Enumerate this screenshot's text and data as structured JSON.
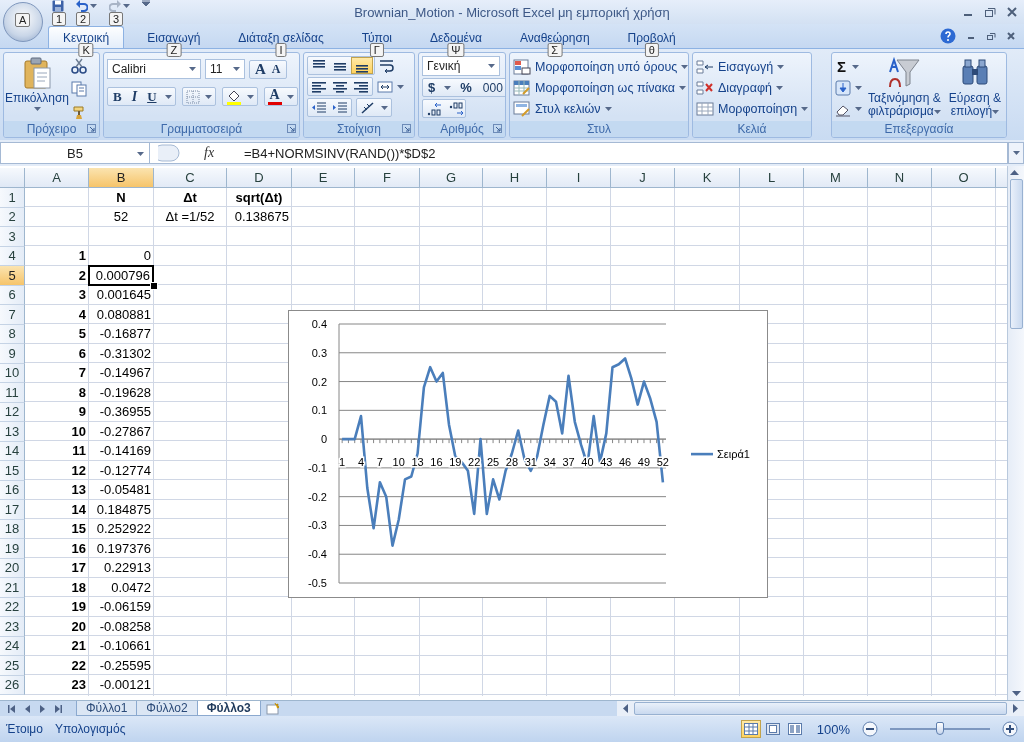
{
  "window": {
    "title": "Brownian_Motion - Microsoft Excel μη εμπορική χρήση",
    "office_keytip": "A",
    "quick_access_keytips": [
      "1",
      "2",
      "3"
    ]
  },
  "tabs": [
    {
      "label": "Κεντρική",
      "keytip": "Κ",
      "selected": true
    },
    {
      "label": "Εισαγωγή",
      "keytip": "Ζ",
      "selected": false
    },
    {
      "label": "Διάταξη σελίδας",
      "keytip": "Ι",
      "selected": false
    },
    {
      "label": "Τύποι",
      "keytip": "Γ",
      "selected": false
    },
    {
      "label": "Δεδομένα",
      "keytip": "Ψ",
      "selected": false
    },
    {
      "label": "Αναθεώρηση",
      "keytip": "Σ",
      "selected": false
    },
    {
      "label": "Προβολή",
      "keytip": "θ",
      "selected": false
    }
  ],
  "ribbon": {
    "groups": [
      {
        "kind": "clipboard",
        "label": "Πρόχειρο",
        "paste_label": "Επικόλληση"
      },
      {
        "kind": "font",
        "label": "Γραμματοσειρά",
        "font_name": "Calibri",
        "font_size": "11",
        "grow_label": "A",
        "shrink_label": "A",
        "bold_label": "B",
        "italic_label": "I",
        "underline_label": "U",
        "font_color_label": "A"
      },
      {
        "kind": "alignment",
        "label": "Στοίχιση",
        "vertical_align": [
          {
            "selected": false
          },
          {
            "selected": false
          },
          {
            "selected": true
          }
        ]
      },
      {
        "kind": "number",
        "label": "Αριθμός",
        "format": "Γενική",
        "currency_label": "$",
        "percent_label": "%",
        "thousands_label": "000"
      },
      {
        "kind": "styles",
        "label": "Στυλ",
        "items": [
          "Μορφοποίηση υπό όρους",
          "Μορφοποίηση ως πίνακα",
          "Στυλ κελιών"
        ]
      },
      {
        "kind": "cells",
        "label": "Κελιά",
        "items": [
          "Εισαγωγή",
          "Διαγραφή",
          "Μορφοποίηση"
        ]
      },
      {
        "kind": "editing",
        "label": "Επεξεργασία",
        "sum_label": "Σ",
        "sort_label": "Ταξινόμηση & φιλτράρισμα",
        "find_label": "Εύρεση & επιλογή"
      }
    ]
  },
  "formula_bar": {
    "name_box": "B5",
    "fx": "fx",
    "formula": "=B4+NORMSINV(RAND())*$D$2"
  },
  "sheet": {
    "columns": [
      {
        "label": "A",
        "selected": false
      },
      {
        "label": "B",
        "selected": true
      },
      {
        "label": "C",
        "selected": false
      },
      {
        "label": "D",
        "selected": false
      },
      {
        "label": "E",
        "selected": false
      },
      {
        "label": "F",
        "selected": false
      },
      {
        "label": "G",
        "selected": false
      },
      {
        "label": "H",
        "selected": false
      },
      {
        "label": "I",
        "selected": false
      },
      {
        "label": "J",
        "selected": false
      },
      {
        "label": "K",
        "selected": false
      },
      {
        "label": "L",
        "selected": false
      },
      {
        "label": "M",
        "selected": false
      },
      {
        "label": "N",
        "selected": false
      },
      {
        "label": "O",
        "selected": false
      }
    ],
    "rows": [
      {
        "number": "1",
        "selected": false,
        "cells": {
          "B": {
            "text": "N",
            "bold": true,
            "centered": true
          },
          "C": {
            "text": "Δt",
            "bold": true,
            "centered": true
          },
          "D": {
            "text": "sqrt(Δt)",
            "bold": true,
            "centered": true
          }
        }
      },
      {
        "number": "2",
        "selected": false,
        "cells": {
          "B": {
            "text": "52",
            "bold": false,
            "centered": true
          },
          "C": {
            "text": "Δt =1/52",
            "bold": false,
            "centered": true
          },
          "D": {
            "text": "0.138675",
            "bold": false,
            "centered": false
          }
        }
      },
      {
        "number": "3",
        "selected": false
      },
      {
        "number": "4",
        "selected": false,
        "cells": {
          "A": {
            "text": "1",
            "bold": true,
            "centered": false
          },
          "B": {
            "text": "0",
            "bold": false,
            "centered": false
          }
        }
      },
      {
        "number": "5",
        "selected": true,
        "cells": {
          "A": {
            "text": "2",
            "bold": true,
            "centered": false
          },
          "B": {
            "text": "0.000796",
            "bold": false,
            "centered": false
          }
        }
      },
      {
        "number": "6",
        "selected": false,
        "cells": {
          "A": {
            "text": "3",
            "bold": true,
            "centered": false
          },
          "B": {
            "text": "0.001645",
            "bold": false,
            "centered": false
          }
        }
      },
      {
        "number": "7",
        "selected": false,
        "cells": {
          "A": {
            "text": "4",
            "bold": true,
            "centered": false
          },
          "B": {
            "text": "0.080881",
            "bold": false,
            "centered": false
          }
        }
      },
      {
        "number": "8",
        "selected": false,
        "cells": {
          "A": {
            "text": "5",
            "bold": true,
            "centered": false
          },
          "B": {
            "text": "-0.16877",
            "bold": false,
            "centered": false
          }
        }
      },
      {
        "number": "9",
        "selected": false,
        "cells": {
          "A": {
            "text": "6",
            "bold": true,
            "centered": false
          },
          "B": {
            "text": "-0.31302",
            "bold": false,
            "centered": false
          }
        }
      },
      {
        "number": "10",
        "selected": false,
        "cells": {
          "A": {
            "text": "7",
            "bold": true,
            "centered": false
          },
          "B": {
            "text": "-0.14967",
            "bold": false,
            "centered": false
          }
        }
      },
      {
        "number": "11",
        "selected": false,
        "cells": {
          "A": {
            "text": "8",
            "bold": true,
            "centered": false
          },
          "B": {
            "text": "-0.19628",
            "bold": false,
            "centered": false
          }
        }
      },
      {
        "number": "12",
        "selected": false,
        "cells": {
          "A": {
            "text": "9",
            "bold": true,
            "centered": false
          },
          "B": {
            "text": "-0.36955",
            "bold": false,
            "centered": false
          }
        }
      },
      {
        "number": "13",
        "selected": false,
        "cells": {
          "A": {
            "text": "10",
            "bold": true,
            "centered": false
          },
          "B": {
            "text": "-0.27867",
            "bold": false,
            "centered": false
          }
        }
      },
      {
        "number": "14",
        "selected": false,
        "cells": {
          "A": {
            "text": "11",
            "bold": true,
            "centered": false
          },
          "B": {
            "text": "-0.14169",
            "bold": false,
            "centered": false
          }
        }
      },
      {
        "number": "15",
        "selected": false,
        "cells": {
          "A": {
            "text": "12",
            "bold": true,
            "centered": false
          },
          "B": {
            "text": "-0.12774",
            "bold": false,
            "centered": false
          }
        }
      },
      {
        "number": "16",
        "selected": false,
        "cells": {
          "A": {
            "text": "13",
            "bold": true,
            "centered": false
          },
          "B": {
            "text": "-0.05481",
            "bold": false,
            "centered": false
          }
        }
      },
      {
        "number": "17",
        "selected": false,
        "cells": {
          "A": {
            "text": "14",
            "bold": true,
            "centered": false
          },
          "B": {
            "text": "0.184875",
            "bold": false,
            "centered": false
          }
        }
      },
      {
        "number": "18",
        "selected": false,
        "cells": {
          "A": {
            "text": "15",
            "bold": true,
            "centered": false
          },
          "B": {
            "text": "0.252922",
            "bold": false,
            "centered": false
          }
        }
      },
      {
        "number": "19",
        "selected": false,
        "cells": {
          "A": {
            "text": "16",
            "bold": true,
            "centered": false
          },
          "B": {
            "text": "0.197376",
            "bold": false,
            "centered": false
          }
        }
      },
      {
        "number": "20",
        "selected": false,
        "cells": {
          "A": {
            "text": "17",
            "bold": true,
            "centered": false
          },
          "B": {
            "text": "0.22913",
            "bold": false,
            "centered": false
          }
        }
      },
      {
        "number": "21",
        "selected": false,
        "cells": {
          "A": {
            "text": "18",
            "bold": true,
            "centered": false
          },
          "B": {
            "text": "0.0472",
            "bold": false,
            "centered": false
          }
        }
      },
      {
        "number": "22",
        "selected": false,
        "cells": {
          "A": {
            "text": "19",
            "bold": true,
            "centered": false
          },
          "B": {
            "text": "-0.06159",
            "bold": false,
            "centered": false
          }
        }
      },
      {
        "number": "23",
        "selected": false,
        "cells": {
          "A": {
            "text": "20",
            "bold": true,
            "centered": false
          },
          "B": {
            "text": "-0.08258",
            "bold": false,
            "centered": false
          }
        }
      },
      {
        "number": "24",
        "selected": false,
        "cells": {
          "A": {
            "text": "21",
            "bold": true,
            "centered": false
          },
          "B": {
            "text": "-0.10661",
            "bold": false,
            "centered": false
          }
        }
      },
      {
        "number": "25",
        "selected": false,
        "cells": {
          "A": {
            "text": "22",
            "bold": true,
            "centered": false
          },
          "B": {
            "text": "-0.25595",
            "bold": false,
            "centered": false
          }
        }
      },
      {
        "number": "26",
        "selected": false,
        "cells": {
          "A": {
            "text": "23",
            "bold": true,
            "centered": false
          },
          "B": {
            "text": "-0.00121",
            "bold": false,
            "centered": false
          }
        }
      }
    ],
    "chart": {
      "chart_data": {
        "type": "line",
        "x": [
          1,
          2,
          3,
          4,
          5,
          6,
          7,
          8,
          9,
          10,
          11,
          12,
          13,
          14,
          15,
          16,
          17,
          18,
          19,
          20,
          21,
          22,
          23,
          24,
          25,
          26,
          27,
          28,
          29,
          30,
          31,
          32,
          33,
          34,
          35,
          36,
          37,
          38,
          39,
          40,
          41,
          42,
          43,
          44,
          45,
          46,
          47,
          48,
          49,
          50,
          51,
          52
        ],
        "xlim": [
          0.5,
          52.5
        ],
        "xticks": [
          1,
          4,
          7,
          10,
          13,
          16,
          19,
          22,
          25,
          28,
          31,
          34,
          37,
          40,
          43,
          46,
          49,
          52
        ],
        "ylim": [
          -0.5,
          0.4
        ],
        "yticks": [
          -0.5,
          -0.4,
          -0.3,
          -0.2,
          -0.1,
          0,
          0.1,
          0.2,
          0.3,
          0.4
        ],
        "grid": true,
        "series": [
          {
            "name": "Σειρά1",
            "color": "#4a7ebb",
            "values": [
              0,
              0,
              0,
              0.08,
              -0.17,
              -0.31,
              -0.15,
              -0.2,
              -0.37,
              -0.28,
              -0.14,
              -0.13,
              -0.05,
              0.18,
              0.25,
              0.2,
              0.23,
              0.05,
              -0.06,
              -0.08,
              -0.11,
              -0.26,
              0,
              -0.26,
              -0.14,
              -0.21,
              -0.11,
              -0.05,
              0.03,
              -0.07,
              -0.11,
              -0.06,
              0.05,
              0.15,
              0.13,
              0.02,
              0.22,
              0.06,
              -0.02,
              -0.09,
              0.08,
              -0.08,
              0.02,
              0.25,
              0.26,
              0.28,
              0.21,
              0.12,
              0.2,
              0.14,
              0.06,
              -0.15
            ]
          }
        ]
      }
    }
  },
  "sheet_tabs": [
    {
      "label": "Φύλλο1",
      "selected": false
    },
    {
      "label": "Φύλλο2",
      "selected": false
    },
    {
      "label": "Φύλλο3",
      "selected": true
    }
  ],
  "status_bar": {
    "items": [
      "Έτοιμο",
      "Υπολογισμός"
    ],
    "views": [
      {
        "selected": true
      },
      {
        "selected": false
      },
      {
        "selected": false
      }
    ],
    "zoom_label": "100%",
    "zoom": {
      "level": 0.5
    }
  }
}
